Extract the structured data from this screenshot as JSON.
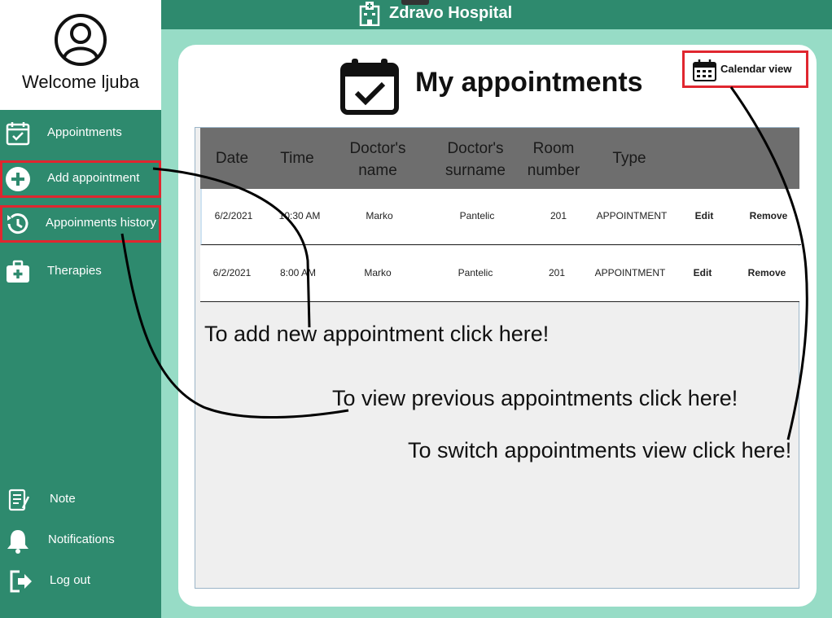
{
  "header": {
    "title": "Zdravo Hospital",
    "icon": "hospital-icon"
  },
  "profile": {
    "welcome": "Welcome ljuba",
    "icon": "user-circle-icon"
  },
  "sidebar": {
    "items": [
      {
        "label": "Appointments",
        "icon": "calendar-check-icon"
      },
      {
        "label": "Add appointment",
        "icon": "plus-circle-icon"
      },
      {
        "label": "Appoinments history",
        "icon": "history-icon"
      },
      {
        "label": "Therapies",
        "icon": "medical-kit-icon"
      },
      {
        "label": "Note",
        "icon": "note-icon"
      },
      {
        "label": "Notifications",
        "icon": "bell-icon"
      },
      {
        "label": "Log out",
        "icon": "logout-icon"
      }
    ]
  },
  "main": {
    "title": "My appointments",
    "calendar_view_label": "Calendar view",
    "columns": [
      {
        "line1": "Date",
        "line2": ""
      },
      {
        "line1": "Time",
        "line2": ""
      },
      {
        "line1": "Doctor's",
        "line2": "name"
      },
      {
        "line1": "Doctor's",
        "line2": "surname"
      },
      {
        "line1": "Room",
        "line2": "number"
      },
      {
        "line1": "Type",
        "line2": ""
      }
    ],
    "rows": [
      {
        "date": "6/2/2021",
        "time": "10:30 AM",
        "name": "Marko",
        "surname": "Pantelic",
        "room": "201",
        "type": "APPOINTMENT",
        "edit": "Edit",
        "remove": "Remove"
      },
      {
        "date": "6/2/2021",
        "time": "8:00 AM",
        "name": "Marko",
        "surname": "Pantelic",
        "room": "201",
        "type": "APPOINTMENT",
        "edit": "Edit",
        "remove": "Remove"
      }
    ]
  },
  "hints": {
    "add": "To add new appointment click here!",
    "history": "To view previous appointments click here!",
    "switch": "To switch appointments view click here!"
  },
  "colors": {
    "sidebar": "#2e8a6e",
    "background": "#97dcc6",
    "highlight": "#e0262f",
    "table_header": "#6e6e6e"
  }
}
